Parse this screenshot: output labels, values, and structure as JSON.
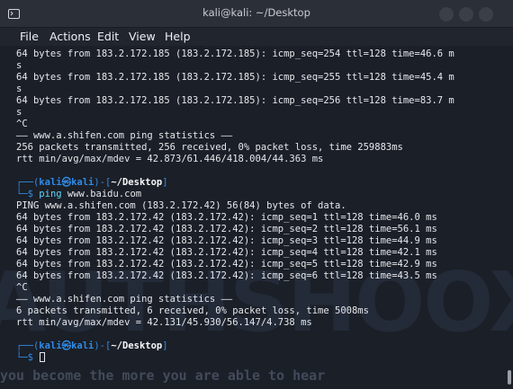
{
  "window": {
    "title": "kali@kali: ~/Desktop"
  },
  "menu": [
    "File",
    "Actions",
    "Edit",
    "View",
    "Help"
  ],
  "watermark": {
    "big_text": "AUTHSHOOX",
    "tagline": "you become the more you are able to hear"
  },
  "terminal": {
    "lines": [
      "64 bytes from 183.2.172.185 (183.2.172.185): icmp_seq=254 ttl=128 time=46.6 m",
      "s",
      "64 bytes from 183.2.172.185 (183.2.172.185): icmp_seq=255 ttl=128 time=45.4 m",
      "s",
      "64 bytes from 183.2.172.185 (183.2.172.185): icmp_seq=256 ttl=128 time=83.7 m",
      "s",
      "^C",
      "—— www.a.shifen.com ping statistics ——",
      "256 packets transmitted, 256 received, 0% packet loss, time 259883ms",
      "rtt min/avg/max/mdev = 42.873/61.446/418.004/44.363 ms",
      "",
      "PROMPT1_TOP",
      "PROMPT1_CMD",
      "PING www.a.shifen.com (183.2.172.42) 56(84) bytes of data.",
      "64 bytes from 183.2.172.42 (183.2.172.42): icmp_seq=1 ttl=128 time=46.0 ms",
      "64 bytes from 183.2.172.42 (183.2.172.42): icmp_seq=2 ttl=128 time=56.1 ms",
      "64 bytes from 183.2.172.42 (183.2.172.42): icmp_seq=3 ttl=128 time=44.9 ms",
      "64 bytes from 183.2.172.42 (183.2.172.42): icmp_seq=4 ttl=128 time=42.1 ms",
      "64 bytes from 183.2.172.42 (183.2.172.42): icmp_seq=5 ttl=128 time=42.9 ms",
      "64 bytes from 183.2.172.42 (183.2.172.42): icmp_seq=6 ttl=128 time=43.5 ms",
      "^C",
      "—— www.a.shifen.com ping statistics ——",
      "6 packets transmitted, 6 received, 0% packet loss, time 5008ms",
      "rtt min/avg/max/mdev = 42.131/45.930/56.147/4.738 ms",
      "",
      "PROMPT2_TOP",
      "PROMPT2_CMD"
    ],
    "prompt1": {
      "open": "┌──(",
      "user": "kali㉿kali",
      "mid": ")-[",
      "path": "~/Desktop",
      "close": "]",
      "arrow": "└─$ ",
      "command": "ping",
      "args": " www.baidu.com"
    },
    "prompt2": {
      "open": "┌──(",
      "user": "kali㉿kali",
      "mid": ")-[",
      "path": "~/Desktop",
      "close": "]",
      "arrow": "└─$ "
    }
  }
}
